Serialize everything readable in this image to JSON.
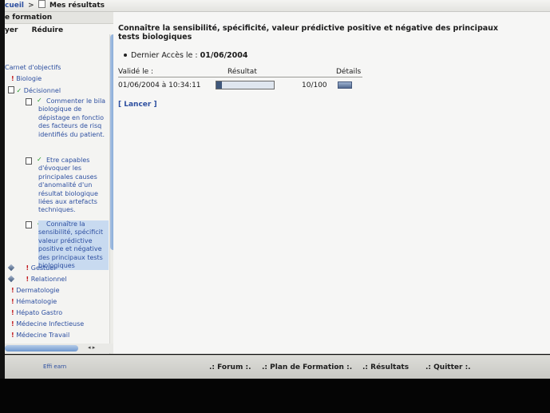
{
  "breadcrumb": {
    "home": "cueil",
    "separator": ">",
    "current": "Mes résultats"
  },
  "left_panel": {
    "header": "e formation",
    "btn_expand": "yer",
    "btn_reduce": "Réduire",
    "tree": {
      "root": "Carnet d'objectifs",
      "biologie": "Biologie",
      "decisionnel": "Décisionnel",
      "objectives": [
        {
          "lines": [
            "Commenter le bila",
            "biologique de",
            "dépistage en fonctio",
            "des facteurs de risq",
            "identifiés du patient."
          ]
        },
        {
          "lines": [
            "Etre capables",
            "d'évoquer les",
            "principales causes",
            "d'anomalité d'un",
            "résultat biologique",
            "liées aux artefacts",
            "techniques."
          ]
        },
        {
          "lines": [
            "Connaître la",
            "sensibilité, spécificit",
            "valeur prédictive",
            "positive et négative",
            "des principaux tests",
            "biologiques"
          ]
        }
      ],
      "gestuel": "Gestuel",
      "relationnel": "Relationnel",
      "others": [
        "Dermatologie",
        "Hématologie",
        "Hépato Gastro",
        "Médecine Infectieuse",
        "Médecine Travail"
      ]
    }
  },
  "main": {
    "title": "Connaître la sensibilité, spécificité, valeur prédictive positive et négative des principaux tests biologiques",
    "last_access_label": "Dernier Accès le :",
    "last_access_date": "01/06/2004",
    "columns": {
      "validated": "Validé le :",
      "result": "Résultat",
      "details": "Détails"
    },
    "row": {
      "date": "01/06/2004 à 10:34:11",
      "score": "10/100",
      "progress_fraction": 0.1
    },
    "launch": "[ Lancer ]"
  },
  "footer": {
    "logo": "Effi earn",
    "nav": [
      ".: Forum :.",
      ".: Plan de Formation :.",
      ".: Résultats",
      ".: Quitter :."
    ]
  },
  "colors": {
    "link": "#2d4fa0",
    "check": "#1f9a23",
    "marker": "#c0141a",
    "selection": "#c8daf0"
  }
}
